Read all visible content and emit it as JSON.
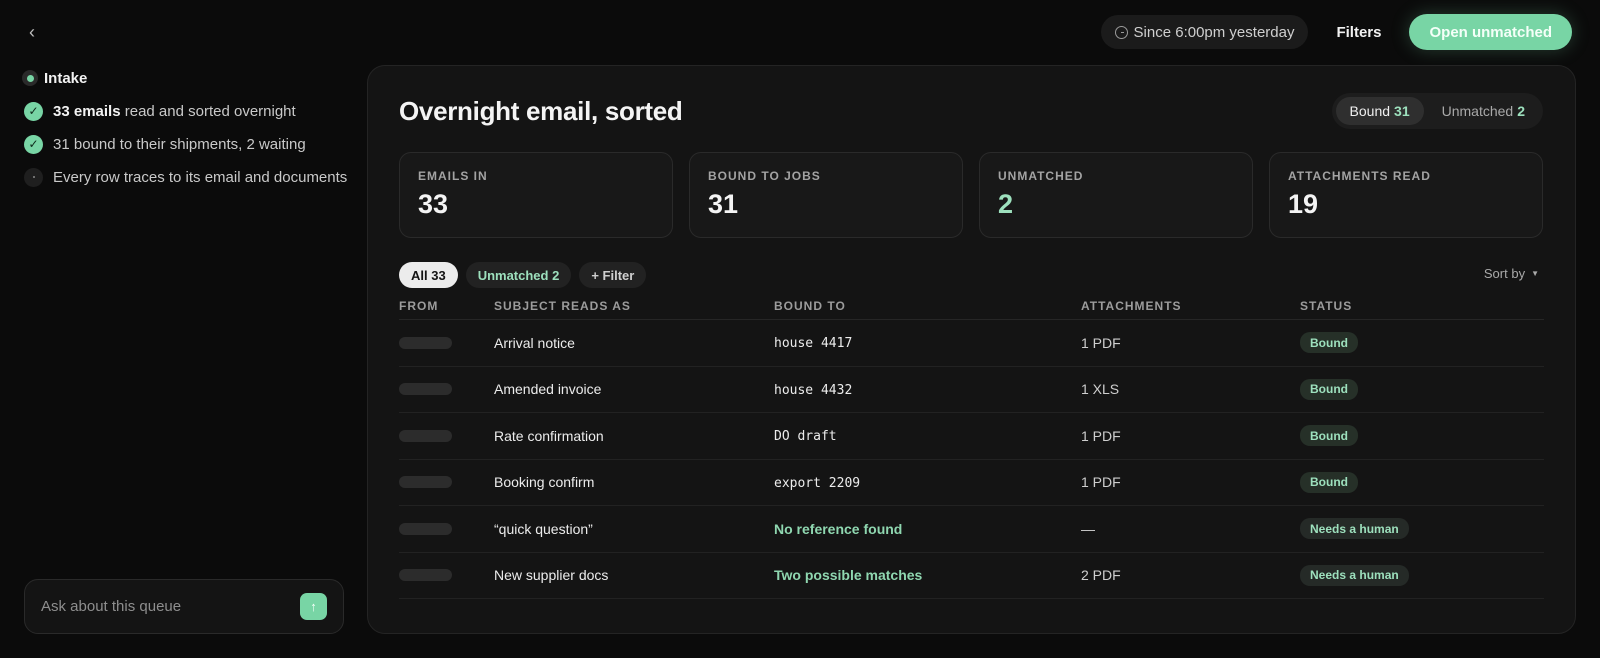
{
  "topbar": {
    "since_label": "Since 6:00pm yesterday",
    "filters_label": "Filters",
    "open_unmatched_label": "Open unmatched"
  },
  "sidebar": {
    "title": "Intake",
    "steps": [
      {
        "bold": "33 emails",
        "text": " read and sorted overnight",
        "state": "done"
      },
      {
        "bold": "",
        "text": "31 bound to their shipments, 2 waiting",
        "state": "done"
      },
      {
        "bold": "",
        "text": "Every row traces to its email and documents",
        "state": "pending"
      }
    ],
    "ask_placeholder": "Ask about this queue"
  },
  "panel": {
    "title": "Overnight email, sorted",
    "segments": [
      {
        "label": "Bound",
        "count": "31",
        "active": true
      },
      {
        "label": "Unmatched",
        "count": "2",
        "active": false
      }
    ],
    "stats": [
      {
        "label": "EMAILS IN",
        "value": "33",
        "accent": false
      },
      {
        "label": "BOUND TO JOBS",
        "value": "31",
        "accent": false
      },
      {
        "label": "UNMATCHED",
        "value": "2",
        "accent": true
      },
      {
        "label": "ATTACHMENTS READ",
        "value": "19",
        "accent": false
      }
    ],
    "chips": [
      {
        "label": "All 33",
        "style": "active"
      },
      {
        "label": "Unmatched 2",
        "style": "accent"
      },
      {
        "label": "+ Filter",
        "style": "plain"
      }
    ],
    "sort_label": "Sort by",
    "columns": [
      "FROM",
      "SUBJECT READS AS",
      "BOUND TO",
      "ATTACHMENTS",
      "STATUS"
    ],
    "rows": [
      {
        "subject": "Arrival notice",
        "bound_to": "house 4417",
        "bound_style": "ref",
        "attachments": "1 PDF",
        "status": "Bound"
      },
      {
        "subject": "Amended invoice",
        "bound_to": "house 4432",
        "bound_style": "ref",
        "attachments": "1 XLS",
        "status": "Bound"
      },
      {
        "subject": "Rate confirmation",
        "bound_to": "DO draft",
        "bound_style": "ref",
        "attachments": "1 PDF",
        "status": "Bound"
      },
      {
        "subject": "Booking confirm",
        "bound_to": "export 2209",
        "bound_style": "ref",
        "attachments": "1 PDF",
        "status": "Bound"
      },
      {
        "subject": "“quick question”",
        "bound_to": "No reference found",
        "bound_style": "accent",
        "attachments": "—",
        "status": "Needs a human"
      },
      {
        "subject": "New supplier docs",
        "bound_to": "Two possible matches",
        "bound_style": "accent",
        "attachments": "2 PDF",
        "status": "Needs a human"
      }
    ]
  },
  "colors": {
    "accent": "#78d5a5",
    "accent_text": "#9de0bd",
    "background": "#0b0b0b",
    "panel": "#141414"
  },
  "icons": {
    "back": "chevron-left-icon",
    "clock": "clock-icon",
    "send": "arrow-up-icon",
    "check": "check-icon"
  }
}
